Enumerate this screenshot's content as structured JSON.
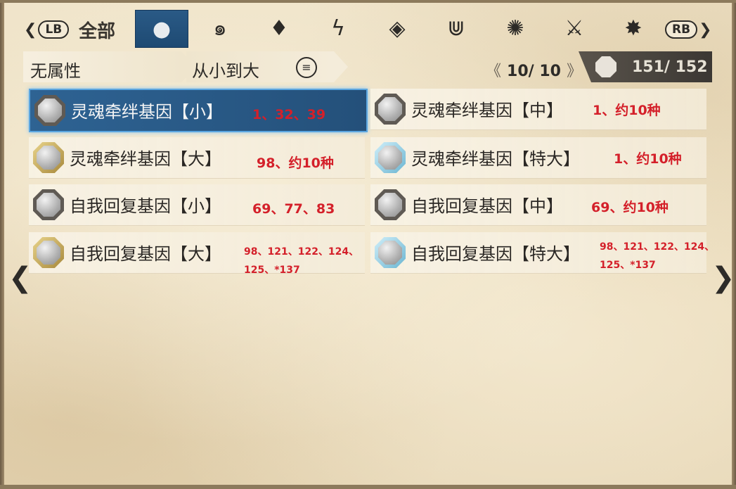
{
  "tabs": {
    "lb_label": "LB",
    "rb_label": "RB",
    "left_arrow": "❮",
    "right_arrow": "❯",
    "all_label": "全部",
    "icons": [
      {
        "name": "neutral-element-icon",
        "glyph": "●",
        "active": true
      },
      {
        "name": "fire-element-icon",
        "glyph": "๑"
      },
      {
        "name": "water-element-icon",
        "glyph": "♦"
      },
      {
        "name": "thunder-element-icon",
        "glyph": "ϟ"
      },
      {
        "name": "ice-element-icon",
        "glyph": "◈"
      },
      {
        "name": "dragon-element-icon",
        "glyph": "⋓"
      },
      {
        "name": "strength-icon",
        "glyph": "✺"
      },
      {
        "name": "skill-icon",
        "glyph": "⚔"
      },
      {
        "name": "explosion-icon",
        "glyph": "✸"
      }
    ]
  },
  "filter": {
    "attribute_label": "无属性",
    "sort_label": "从小到大",
    "sort_icon": "≡"
  },
  "pager": {
    "prev": "《",
    "next": "》",
    "current": "10/ 10"
  },
  "count": {
    "text": "151/  152"
  },
  "items": [
    {
      "name": "灵魂牵绊基因【小】",
      "note": "1、32、39",
      "rarity": "gray",
      "selected": true
    },
    {
      "name": "灵魂牵绊基因【中】",
      "note": "1、约10种",
      "rarity": "gray"
    },
    {
      "name": "灵魂牵绊基因【大】",
      "note": "98、约10种",
      "rarity": "gold"
    },
    {
      "name": "灵魂牵绊基因【特大】",
      "note": "1、约10种",
      "rarity": "blue"
    },
    {
      "name": "自我回复基因【小】",
      "note": "69、77、83",
      "rarity": "gray"
    },
    {
      "name": "自我回复基因【中】",
      "note": "69、约10种",
      "rarity": "gray"
    },
    {
      "name": "自我回复基因【大】",
      "note_line1": "98、121、122、124、",
      "note_line2": "125、*137",
      "rarity": "gold"
    },
    {
      "name": "自我回复基因【特大】",
      "note_line1": "98、121、122、124、",
      "note_line2": "125、*137",
      "rarity": "blue"
    }
  ],
  "nav": {
    "prev_page": "❮",
    "next_page": "❯"
  },
  "colors": {
    "accent_blue": "#24507a",
    "note_red": "#d4202a",
    "parchment": "#e9dcc0"
  }
}
